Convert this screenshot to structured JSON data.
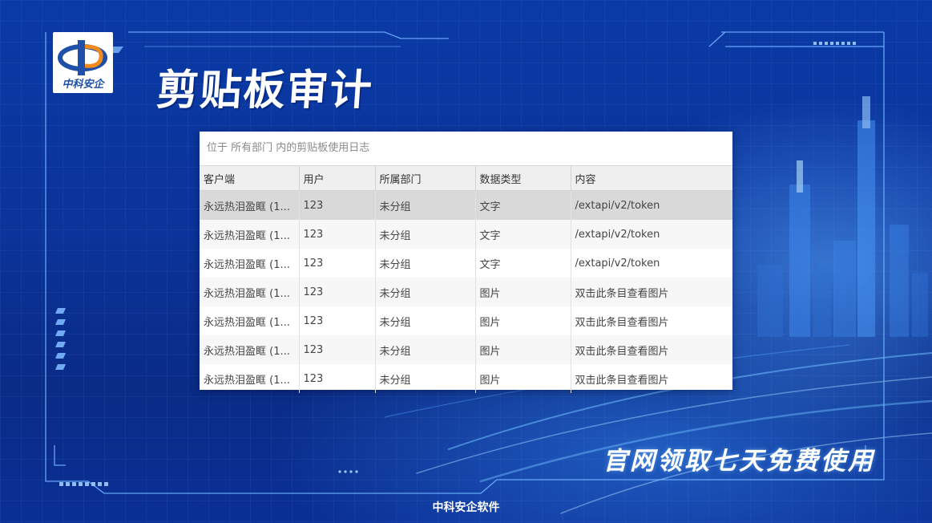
{
  "slide": {
    "title": "剪贴板审计",
    "logo_text": "中科安企",
    "slogan": "官网领取七天免费使用",
    "footer": "中科安企软件"
  },
  "panel": {
    "breadcrumb": "位于 所有部门 内的剪贴板使用日志",
    "columns": [
      "客户端",
      "用户",
      "所属部门",
      "数据类型",
      "内容"
    ],
    "rows": [
      {
        "client": "永远热泪盈眶 (1...",
        "user": "123",
        "dept": "未分组",
        "type": "文字",
        "content": "/extapi/v2/token"
      },
      {
        "client": "永远热泪盈眶 (1...",
        "user": "123",
        "dept": "未分组",
        "type": "文字",
        "content": "/extapi/v2/token"
      },
      {
        "client": "永远热泪盈眶 (1...",
        "user": "123",
        "dept": "未分组",
        "type": "文字",
        "content": "/extapi/v2/token"
      },
      {
        "client": "永远热泪盈眶 (1...",
        "user": "123",
        "dept": "未分组",
        "type": "图片",
        "content": "双击此条目查看图片"
      },
      {
        "client": "永远热泪盈眶 (1...",
        "user": "123",
        "dept": "未分组",
        "type": "图片",
        "content": "双击此条目查看图片"
      },
      {
        "client": "永远热泪盈眶 (1...",
        "user": "123",
        "dept": "未分组",
        "type": "图片",
        "content": "双击此条目查看图片"
      },
      {
        "client": "永远热泪盈眶 (1...",
        "user": "123",
        "dept": "未分组",
        "type": "图片",
        "content": "双击此条目查看图片"
      }
    ],
    "selected_row": 0
  },
  "colors": {
    "background": "#0a3399",
    "frame_line": "#6fb2ff",
    "logo_blue": "#1f4fa8",
    "logo_orange": "#f08a1c"
  }
}
